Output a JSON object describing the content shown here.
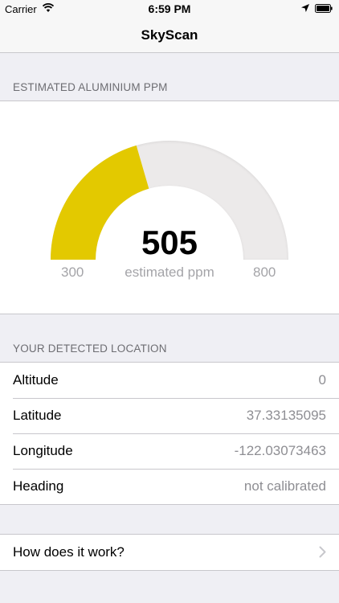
{
  "status_bar": {
    "carrier": "Carrier",
    "time": "6:59 PM",
    "icons": [
      "wifi-icon",
      "location-arrow-icon",
      "battery-icon"
    ]
  },
  "nav": {
    "title": "SkyScan"
  },
  "gauge_section": {
    "header": "ESTIMATED ALUMINIUM PPM",
    "value": "505",
    "value_number": 505,
    "unit": "estimated ppm",
    "min_label": "300",
    "max_label": "800",
    "min": 300,
    "max": 800,
    "fill_color": "#e3c900",
    "track_color": "#eceaea"
  },
  "location_section": {
    "header": "YOUR DETECTED LOCATION",
    "rows": [
      {
        "label": "Altitude",
        "value": "0"
      },
      {
        "label": "Latitude",
        "value": "37.33135095"
      },
      {
        "label": "Longitude",
        "value": "-122.03073463"
      },
      {
        "label": "Heading",
        "value": "not calibrated"
      }
    ]
  },
  "info_section": {
    "link_label": "How does it work?",
    "icon": "chevron-right-icon"
  }
}
